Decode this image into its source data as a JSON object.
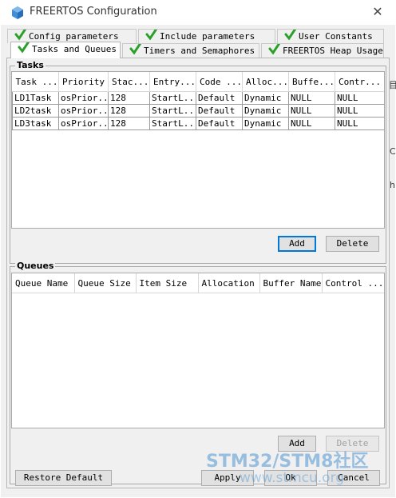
{
  "window": {
    "title": "FREERTOS Configuration",
    "close_glyph": "✕",
    "accent": "#0078d7",
    "check_color": "#2aa02a"
  },
  "tabs": {
    "row1": [
      {
        "label": "Config parameters"
      },
      {
        "label": "Include parameters"
      },
      {
        "label": "User Constants"
      }
    ],
    "row2": [
      {
        "label": "Tasks and Queues",
        "active": true
      },
      {
        "label": "Timers and Semaphores"
      },
      {
        "label": "FREERTOS Heap Usage"
      }
    ]
  },
  "tasks": {
    "group_title": "Tasks",
    "columns": [
      "Task ...",
      "Priority",
      "Stac...",
      "Entry...",
      "Code ...",
      "Alloc...",
      "Buffe...",
      "Contr..."
    ],
    "rows": [
      [
        "LD1Task",
        "osPrior...",
        "128",
        "StartL...",
        "Default",
        "Dynamic",
        "NULL",
        "NULL"
      ],
      [
        "LD2task",
        "osPrior...",
        "128",
        "StartL...",
        "Default",
        "Dynamic",
        "NULL",
        "NULL"
      ],
      [
        "LD3task",
        "osPrior...",
        "128",
        "StartL...",
        "Default",
        "Dynamic",
        "NULL",
        "NULL"
      ]
    ],
    "add_label": "Add",
    "delete_label": "Delete"
  },
  "queues": {
    "group_title": "Queues",
    "columns": [
      "Queue Name",
      "Queue Size",
      "Item Size",
      "Allocation",
      "Buffer Name",
      "Control ..."
    ],
    "rows": [],
    "add_label": "Add",
    "delete_label": "Delete"
  },
  "footer": {
    "restore_label": "Restore Default",
    "apply_label": "Apply",
    "ok_label": "Ok",
    "cancel_label": "Cancel"
  },
  "background_fragments": [
    "目",
    "C",
    "h"
  ],
  "watermark": {
    "line1": "STM32/STM8社区",
    "line2": "www.stmcu.org"
  }
}
